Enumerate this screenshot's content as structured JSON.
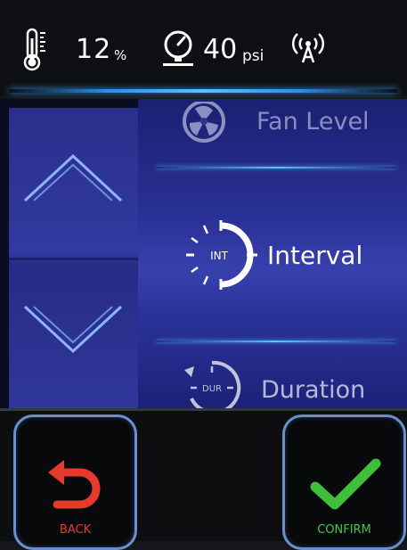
{
  "status": {
    "humidity_value": "12",
    "humidity_unit": "%",
    "pressure_value": "40",
    "pressure_unit": "psi",
    "icons": [
      "thermometer-icon",
      "pressure-gauge-icon",
      "signal-antenna-icon"
    ]
  },
  "menu": {
    "items": [
      {
        "label": "Fan Level",
        "icon": "fan-icon",
        "state": "dimmed"
      },
      {
        "label": "Interval",
        "icon_text": "INT",
        "icon": "interval-dial-icon",
        "state": "selected"
      },
      {
        "label": "Duration",
        "icon_text": "DUR",
        "icon": "duration-dial-icon",
        "state": "dimmed"
      }
    ]
  },
  "buttons": {
    "back_label": "BACK",
    "confirm_label": "CONFIRM"
  },
  "colors": {
    "accent_glow": "#5ec0ff",
    "back_red": "#e53a2c",
    "confirm_green": "#44c83e",
    "panel_blue": "#323aa0"
  }
}
